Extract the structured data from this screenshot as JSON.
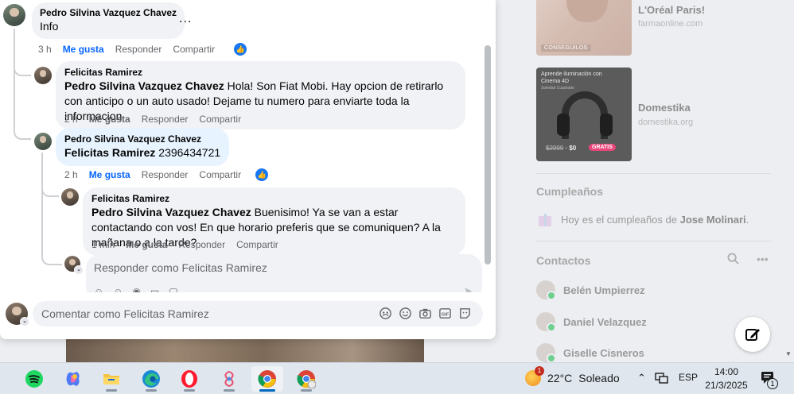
{
  "right_column": {
    "ads": [
      {
        "title": "L'Oréal Paris!",
        "domain": "farmaonline.com",
        "image_tag": "CONSEGUILOS"
      },
      {
        "title": "Domestika",
        "domain": "domestika.org",
        "image_text": "Aprende iluminación con Cinema 4D",
        "image_subtext": "Soledad Cuadrado",
        "price_old": "$2999",
        "price_new": "$0",
        "badge": "GRATIS"
      }
    ],
    "birthdays": {
      "title": "Cumpleaños",
      "text_before": "Hoy es el cumpleaños de ",
      "name": "Jose Molinari",
      "text_after": "."
    },
    "contacts": {
      "title": "Contactos",
      "items": [
        {
          "name": "Belén Umpierrez"
        },
        {
          "name": "Daniel Velazquez"
        },
        {
          "name": "Giselle Cisneros"
        }
      ]
    }
  },
  "comments": [
    {
      "author": "Pedro Silvina Vazquez Chavez",
      "text": "Info",
      "time": "3 h",
      "like_label": "Me gusta",
      "liked": true,
      "reply_label": "Responder",
      "share_label": "Compartir",
      "more": "..."
    },
    {
      "author": "Felicitas Ramirez",
      "mention": "Pedro Silvina Vazquez Chavez",
      "text": " Hola! Son Fiat Mobi. Hay opcion de retirarlo con anticipo o un auto usado! Dejame tu numero para enviarte toda la informacion",
      "time": "2 h",
      "like_label": "Me gusta",
      "reply_label": "Responder",
      "share_label": "Compartir"
    },
    {
      "author": "Pedro Silvina Vazquez Chavez",
      "mention": "Felicitas Ramirez",
      "text": " 2396434721",
      "time": "2 h",
      "like_label": "Me gusta",
      "liked": true,
      "reply_label": "Responder",
      "share_label": "Compartir"
    },
    {
      "author": "Felicitas Ramirez",
      "mention": "Pedro Silvina Vazquez Chavez",
      "text": " Buenisimo! Ya se van a estar contactando con vos! En que horario preferis que se comuniquen? A la mañana o a la tarde?",
      "time": "1 min",
      "like_label": "Me gusta",
      "reply_label": "Responder",
      "share_label": "Compartir"
    }
  ],
  "reply_box": {
    "placeholder": "Responder como Felicitas Ramirez"
  },
  "comment_box": {
    "placeholder": "Comentar como Felicitas Ramirez"
  },
  "taskbar": {
    "apps": [
      "spotify-icon",
      "copilot-icon",
      "file-explorer-icon",
      "edge-icon",
      "opera-icon",
      "mirage-app-icon",
      "chrome-icon",
      "chrome-profile-icon"
    ],
    "weather": {
      "temp": "22°C",
      "condition": "Soleado",
      "badge": "1"
    },
    "language": "ESP",
    "time": "14:00",
    "date": "21/3/2025",
    "notifications_badge": "1"
  },
  "colors": {
    "accent": "#0866ff",
    "bubble": "#f0f2f5",
    "highlight_bubble": "#e7f3ff",
    "text_secondary": "#65676b"
  }
}
